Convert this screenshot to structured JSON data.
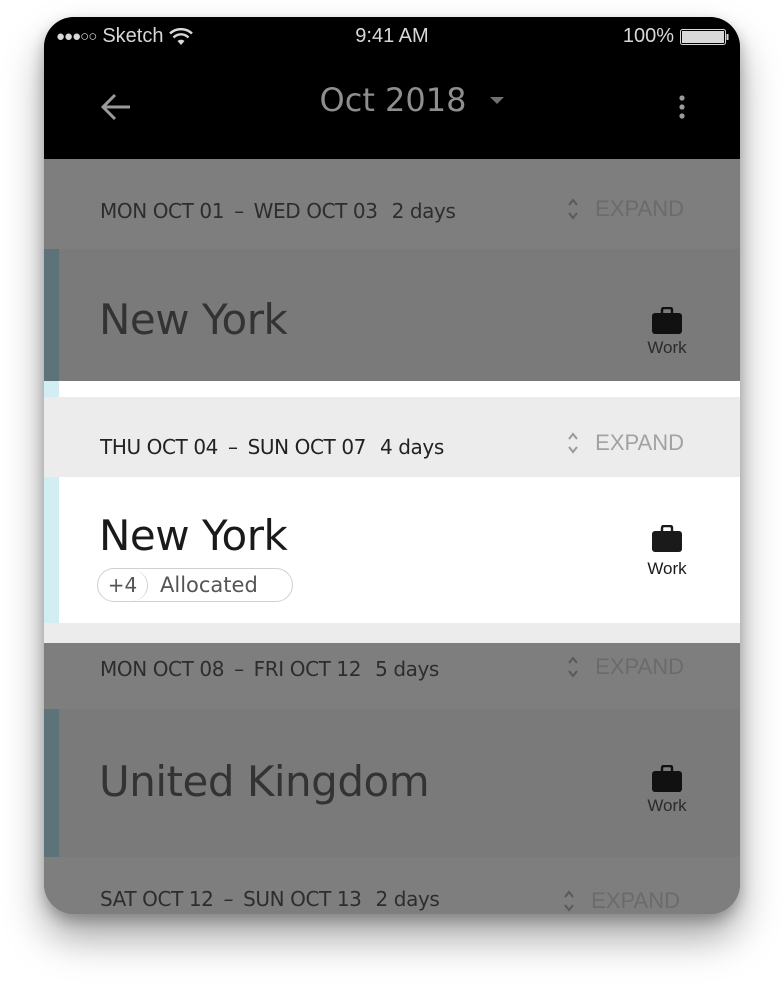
{
  "status_bar": {
    "carrier": "Sketch",
    "signal_dots": "●●●○○",
    "time": "9:41 AM",
    "battery": "100%"
  },
  "header": {
    "title": "Oct 2018",
    "icons": [
      "back-arrow-icon",
      "caret-down-icon",
      "more-vert-icon"
    ]
  },
  "groups": [
    {
      "start": "MON OCT 01",
      "end": "WED OCT 03",
      "days": "2 days",
      "expand_label": "EXPAND",
      "trip": {
        "title": "New York",
        "tag": "Work",
        "tag_icon": "briefcase-icon"
      }
    },
    {
      "start": "THU OCT 04",
      "end": "SUN OCT 07",
      "days": "4 days",
      "expand_label": "EXPAND",
      "trip": {
        "title": "New York",
        "tag": "Work",
        "tag_icon": "briefcase-icon",
        "allocated_count": "+4",
        "allocated_label": "Allocated"
      }
    },
    {
      "start": "MON OCT 08",
      "end": "FRI OCT 12",
      "days": "5 days",
      "expand_label": "EXPAND",
      "trip": {
        "title": "United Kingdom",
        "tag": "Work",
        "tag_icon": "briefcase-icon"
      }
    },
    {
      "start": "SAT OCT 12",
      "end": "SUN OCT 13",
      "days": "2 days",
      "expand_label": "EXPAND"
    }
  ],
  "range_separator": "–",
  "colors": {
    "dim_overlay": "#7a7a7a",
    "accent_highlight": "#d2eef3",
    "accent_dim": "#5c7379"
  }
}
